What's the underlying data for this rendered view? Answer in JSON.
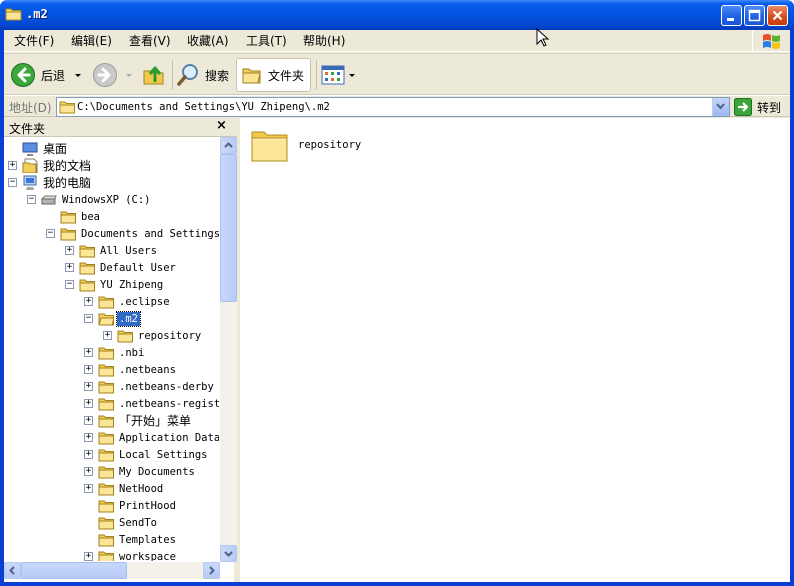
{
  "window": {
    "title": ".m2"
  },
  "menu": [
    {
      "label": "文件(F)"
    },
    {
      "label": "编辑(E)"
    },
    {
      "label": "查看(V)"
    },
    {
      "label": "收藏(A)"
    },
    {
      "label": "工具(T)"
    },
    {
      "label": "帮助(H)"
    }
  ],
  "toolbar": {
    "back_label": "后退",
    "search_label": "搜索",
    "folders_label": "文件夹"
  },
  "address": {
    "label": "地址(D)",
    "value": "C:\\Documents and Settings\\YU Zhipeng\\.m2",
    "go_label": "转到"
  },
  "folder_pane": {
    "title": "文件夹",
    "close": "×",
    "tree": [
      {
        "label": "桌面",
        "level": 0,
        "icon": "desktop-icon",
        "expander": ""
      },
      {
        "label": "我的文档",
        "level": 0,
        "icon": "my-documents-icon",
        "expander": "+"
      },
      {
        "label": "我的电脑",
        "level": 0,
        "icon": "my-computer-icon",
        "expander": "-"
      },
      {
        "label": "WindowsXP (C:)",
        "level": 1,
        "icon": "drive-icon",
        "expander": "-"
      },
      {
        "label": "bea",
        "level": 2,
        "icon": "folder-icon",
        "expander": ""
      },
      {
        "label": "Documents and Settings",
        "level": 2,
        "icon": "folder-icon",
        "expander": "-"
      },
      {
        "label": "All Users",
        "level": 3,
        "icon": "folder-icon",
        "expander": "+"
      },
      {
        "label": "Default User",
        "level": 3,
        "icon": "folder-icon",
        "expander": "+"
      },
      {
        "label": "YU Zhipeng",
        "level": 3,
        "icon": "folder-icon",
        "expander": "-"
      },
      {
        "label": ".eclipse",
        "level": 4,
        "icon": "folder-icon",
        "expander": "+"
      },
      {
        "label": ".m2",
        "level": 4,
        "icon": "folder-open-icon",
        "expander": "-",
        "selected": true
      },
      {
        "label": "repository",
        "level": 5,
        "icon": "folder-icon",
        "expander": "+"
      },
      {
        "label": ".nbi",
        "level": 4,
        "icon": "folder-icon",
        "expander": "+"
      },
      {
        "label": ".netbeans",
        "level": 4,
        "icon": "folder-icon",
        "expander": "+"
      },
      {
        "label": ".netbeans-derby",
        "level": 4,
        "icon": "folder-icon",
        "expander": "+"
      },
      {
        "label": ".netbeans-registr",
        "level": 4,
        "icon": "folder-icon",
        "expander": "+"
      },
      {
        "label": "「开始」菜单",
        "level": 4,
        "icon": "folder-icon",
        "expander": "+"
      },
      {
        "label": "Application Data",
        "level": 4,
        "icon": "folder-icon",
        "expander": "+"
      },
      {
        "label": "Local Settings",
        "level": 4,
        "icon": "folder-icon",
        "expander": "+"
      },
      {
        "label": "My Documents",
        "level": 4,
        "icon": "folder-icon",
        "expander": "+"
      },
      {
        "label": "NetHood",
        "level": 4,
        "icon": "folder-icon",
        "expander": "+"
      },
      {
        "label": "PrintHood",
        "level": 4,
        "icon": "folder-icon",
        "expander": ""
      },
      {
        "label": "SendTo",
        "level": 4,
        "icon": "folder-icon",
        "expander": ""
      },
      {
        "label": "Templates",
        "level": 4,
        "icon": "folder-icon",
        "expander": ""
      },
      {
        "label": "workspace",
        "level": 4,
        "icon": "folder-icon",
        "expander": "+"
      }
    ]
  },
  "content": {
    "items": [
      {
        "label": "repository",
        "icon": "folder-large-icon"
      }
    ]
  },
  "colors": {
    "titlebar": "#0453e0",
    "selection": "#316ac5",
    "chrome": "#ece9d8"
  }
}
